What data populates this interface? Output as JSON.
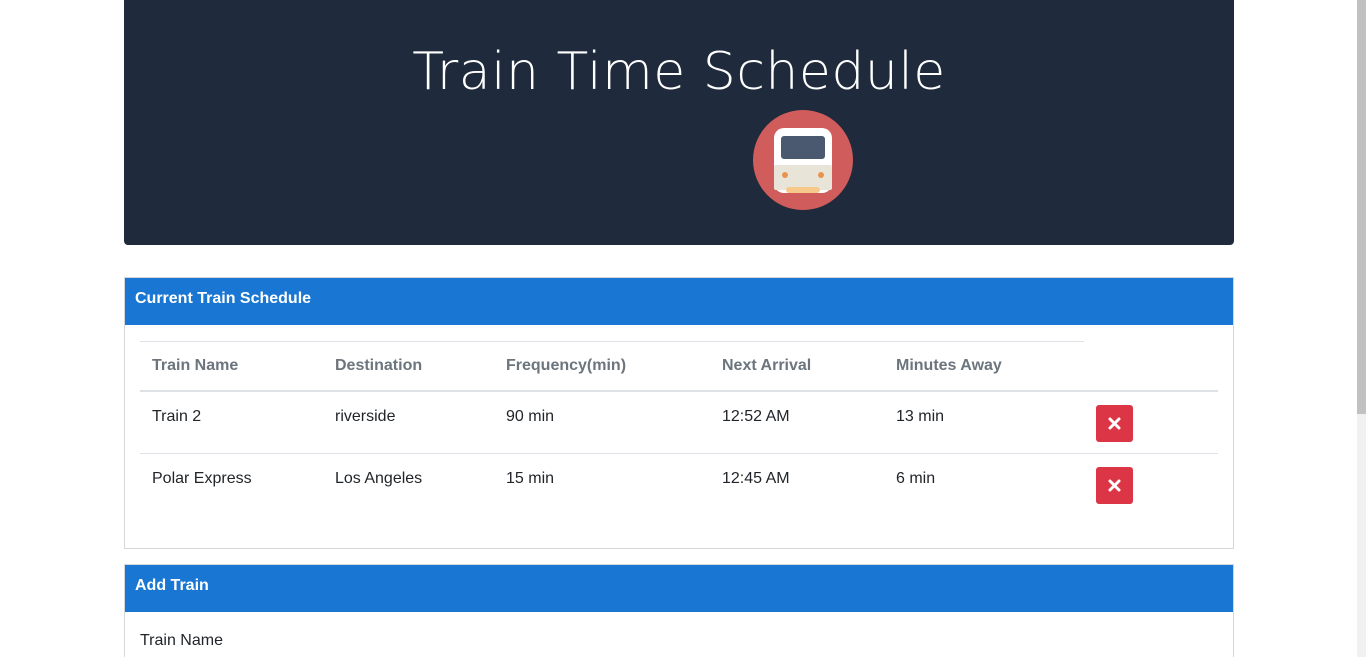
{
  "header": {
    "title": "Train Time Schedule",
    "logo_icon": "train-icon",
    "background_color": "#1f2b3c"
  },
  "schedule": {
    "title": "Current Train Schedule",
    "header_color": "#1976d2",
    "columns": [
      "Train Name",
      "Destination",
      "Frequency(min)",
      "Next Arrival",
      "Minutes Away"
    ],
    "rows": [
      {
        "name": "Train 2",
        "destination": "riverside",
        "frequency": "90 min",
        "next_arrival": "12:52 AM",
        "minutes_away": "13 min"
      },
      {
        "name": "Polar Express",
        "destination": "Los Angeles",
        "frequency": "15 min",
        "next_arrival": "12:45 AM",
        "minutes_away": "6 min"
      }
    ],
    "delete_icon": "close-icon",
    "delete_color": "#dc3545"
  },
  "add_train": {
    "title": "Add Train",
    "train_name_label": "Train Name"
  }
}
